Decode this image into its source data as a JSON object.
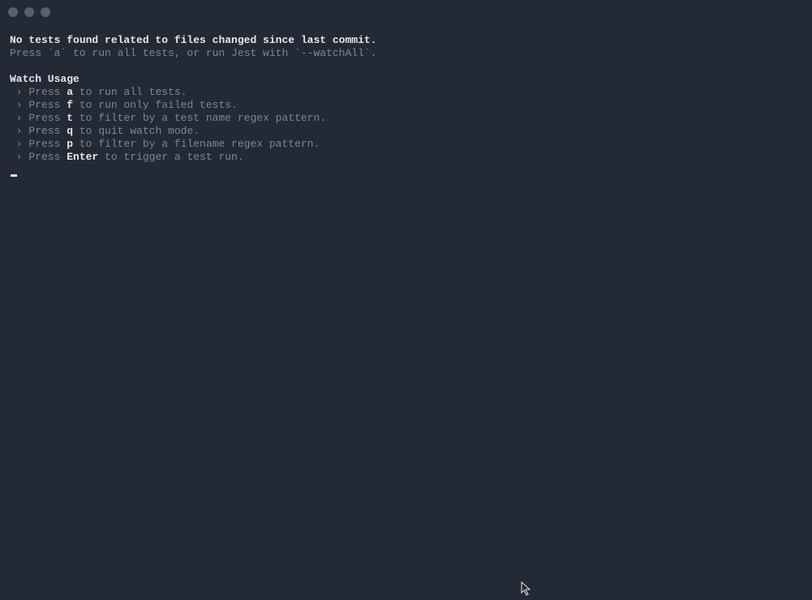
{
  "header": {
    "no_tests": "No tests found related to files changed since last commit.",
    "hint": "Press `a` to run all tests, or run Jest with `--watchAll`."
  },
  "watch": {
    "title": "Watch Usage",
    "caret": " › ",
    "press": "Press ",
    "items": [
      {
        "key": "a",
        "desc": " to run all tests."
      },
      {
        "key": "f",
        "desc": " to run only failed tests."
      },
      {
        "key": "t",
        "desc": " to filter by a test name regex pattern."
      },
      {
        "key": "q",
        "desc": " to quit watch mode."
      },
      {
        "key": "p",
        "desc": " to filter by a filename regex pattern."
      },
      {
        "key": "Enter",
        "desc": " to trigger a test run."
      }
    ]
  }
}
